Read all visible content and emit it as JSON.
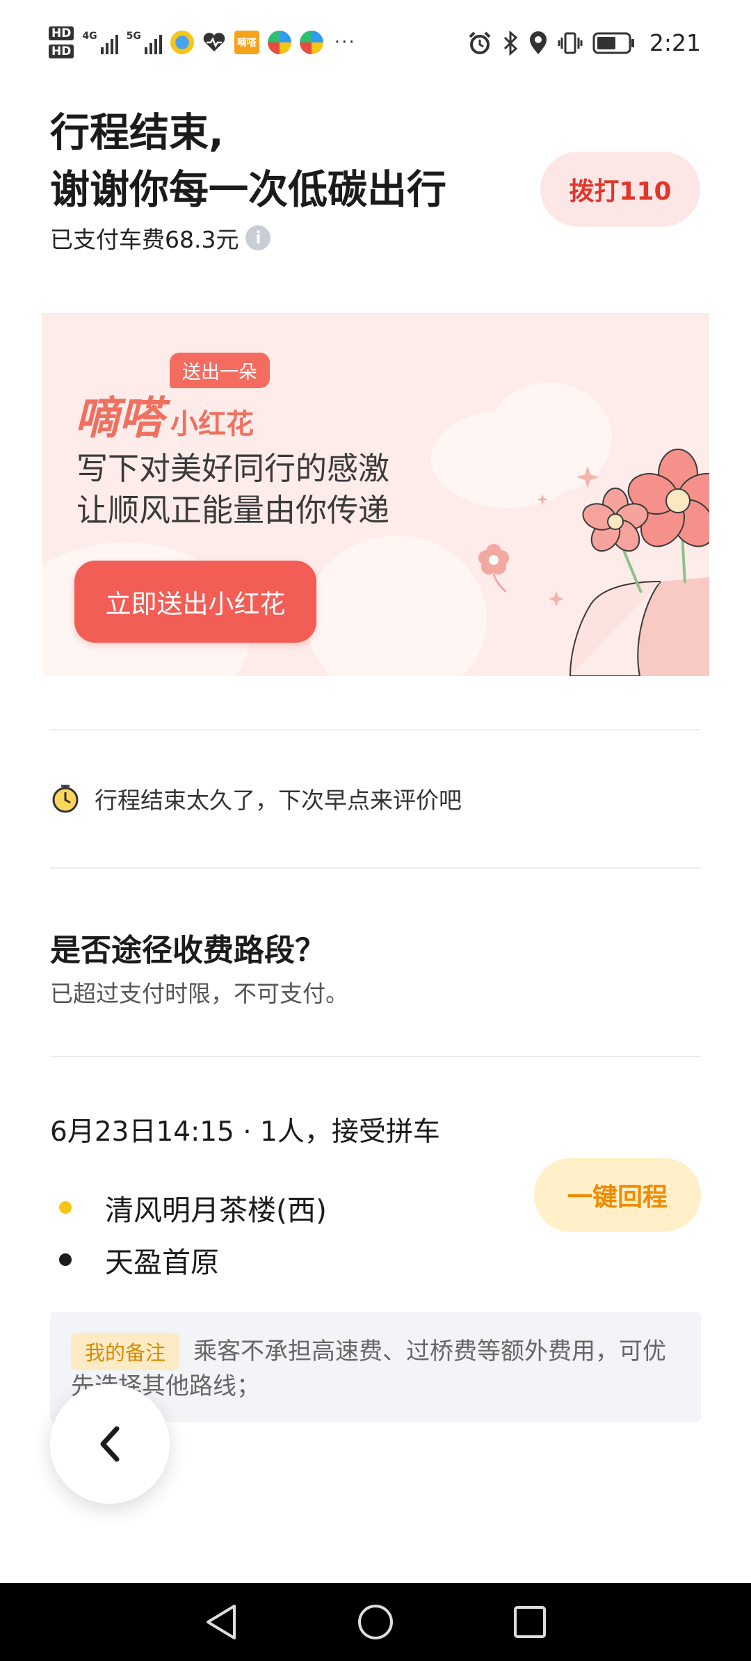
{
  "status_bar": {
    "hd1": "HD",
    "hd2": "HD",
    "sig1_label": "4G",
    "sig2_label": "5G",
    "app_badge": "嘀嗒",
    "more": "···",
    "time": "2:21",
    "icons": [
      "alarm-icon",
      "bluetooth-icon",
      "location-icon",
      "vibrate-icon",
      "battery-icon"
    ]
  },
  "header": {
    "title_line1": "行程结束,",
    "title_line2": "谢谢你每一次低碳出行",
    "fare": "已支付车费68.3元",
    "info": "i",
    "call_button": "拨打110"
  },
  "banner": {
    "tag": "送出一朵",
    "brand_main": "嘀嗒",
    "brand_sub": "小红花",
    "line1": "写下对美好同行的感激",
    "line2": "让顺风正能量由你传递",
    "button": "立即送出小红花"
  },
  "review": {
    "text": "行程结束太久了，下次早点来评价吧"
  },
  "toll": {
    "question": "是否途径收费路段？",
    "answer": "已超过支付时限，不可支付。"
  },
  "trip": {
    "info": "6月23日14:15 · 1人，接受拼车",
    "start": "清风明月茶楼(西)",
    "end": "天盈首原",
    "return_button": "一键回程",
    "colors": {
      "start_dot": "#f5c518",
      "end_dot": "#1b1b1b"
    }
  },
  "note": {
    "tag": "我的备注",
    "text": "乘客不承担高速费、过桥费等额外费用，可优先选择其他路线；"
  },
  "colors": {
    "accent_red": "#e2362d",
    "banner_bg": "#fdecea",
    "return_bg": "#fff0c9",
    "return_text": "#f08a00"
  }
}
